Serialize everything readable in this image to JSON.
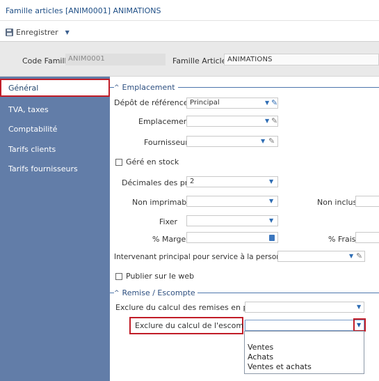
{
  "window": {
    "title": "Famille articles [ANIM0001] ANIMATIONS"
  },
  "toolbar": {
    "save_label": "Enregistrer"
  },
  "header": {
    "code_famille_label": "Code Famille",
    "code_famille_value": "ANIM0001",
    "famille_articles_label": "Famille Articles",
    "famille_articles_value": "ANIMATIONS"
  },
  "sidebar": {
    "items": [
      {
        "label": "Général",
        "active": true
      },
      {
        "label": "TVA, taxes",
        "active": false
      },
      {
        "label": "Comptabilité",
        "active": false
      },
      {
        "label": "Tarifs clients",
        "active": false
      },
      {
        "label": "Tarifs fournisseurs",
        "active": false
      }
    ]
  },
  "emplacement": {
    "section_title": "Emplacement",
    "depot_label": "Dépôt de référence",
    "depot_value": "Principal",
    "emplacement_label": "Emplacement",
    "emplacement_value": "",
    "fournisseur_label": "Fournisseur",
    "fournisseur_value": "",
    "gere_en_stock_label": "Géré en stock",
    "gere_en_stock_checked": false,
    "decimales_label": "Décimales des prix",
    "decimales_value": "2",
    "non_imprimable_label": "Non imprimable",
    "non_imprimable_value": "",
    "non_inclus_label": "Non inclus",
    "non_inclus_value": "",
    "fixer_label": "Fixer",
    "fixer_value": "",
    "marge_label": "% Marge",
    "marge_value": "",
    "frais_label": "% Frais",
    "frais_value": "",
    "intervenant_label": "Intervenant principal pour service à la personne",
    "intervenant_value": "",
    "publier_web_label": "Publier sur le web",
    "publier_web_checked": false
  },
  "remise": {
    "section_title": "Remise / Escompte",
    "exclure_remises_label": "Exclure du calcul des remises en pied",
    "exclure_remises_value": "",
    "exclure_escompte_label": "Exclure du calcul de l'escompte",
    "exclure_escompte_value": "",
    "escompte_options": [
      "Ventes",
      "Achats",
      "Ventes et achats"
    ]
  },
  "colors": {
    "sidebar_bg": "#627da8",
    "highlight_red": "#c11d28",
    "accent_blue": "#2f6db4",
    "title_blue": "#1f4f86"
  },
  "icons": {
    "save": "save-icon",
    "dropdown": "chevron-down-icon",
    "edit": "pencil-icon",
    "calculator": "calculator-icon",
    "collapse": "chevron-up-icon"
  }
}
